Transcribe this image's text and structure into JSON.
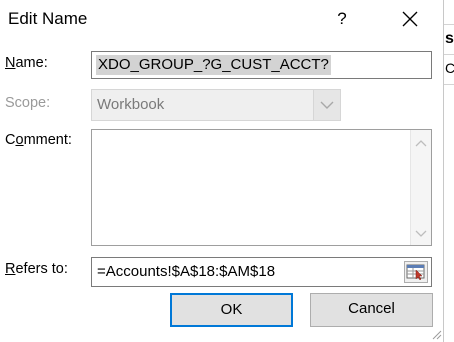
{
  "dialog": {
    "title": "Edit Name",
    "help_label": "?",
    "close_icon": "close-icon"
  },
  "name": {
    "label_pre": "",
    "label_accel": "N",
    "label_post": "ame:",
    "value": "XDO_GROUP_?G_CUST_ACCT?"
  },
  "scope": {
    "label": "Scope:",
    "value": "Workbook",
    "enabled": false
  },
  "comment": {
    "label_pre": "C",
    "label_accel": "o",
    "label_post": "mment:",
    "value": ""
  },
  "refers_to": {
    "label_pre": "",
    "label_accel": "R",
    "label_post": "efers to:",
    "value": "=Accounts!$A$18:$AM$18"
  },
  "buttons": {
    "ok": "OK",
    "cancel": "Cancel"
  },
  "background_sheet": {
    "cell_top": "st",
    "cell_second": "CH"
  },
  "colors": {
    "ok_focus": "#0078d7",
    "selection": "#d3d3d3",
    "button_face": "#e1e1e1"
  }
}
